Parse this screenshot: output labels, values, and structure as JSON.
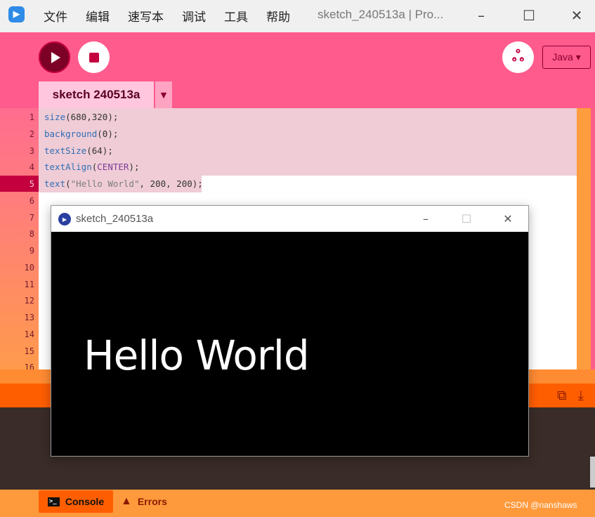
{
  "window": {
    "title": "sketch_240513a | Pro...",
    "menu": [
      "文件",
      "编辑",
      "速写本",
      "调试",
      "工具",
      "帮助"
    ]
  },
  "toolbar": {
    "mode": "Java ▾"
  },
  "editor": {
    "tab_label": "sketch 240513a",
    "line_numbers": [
      "1",
      "2",
      "3",
      "4",
      "5",
      "6",
      "7",
      "8",
      "9",
      "10",
      "11",
      "12",
      "13",
      "14",
      "15",
      "16"
    ],
    "code_lines": [
      "size(680,320);",
      "background(0);",
      "textSize(64);",
      "textAlign(CENTER);",
      "text(\"Hello World\", 200, 200);"
    ],
    "code_tokens": {
      "l1_fn": "size",
      "l1_rest": "(680,320);",
      "l2_fn": "background",
      "l2_rest": "(0);",
      "l3_fn": "textSize",
      "l3_rest": "(64);",
      "l4_fn": "textAlign",
      "l4_open": "(",
      "l4_const": "CENTER",
      "l4_close": ");",
      "l5_fn": "text",
      "l5_open": "(",
      "l5_str": "\"Hello World\"",
      "l5_rest": ", 200, 200);"
    }
  },
  "console": {
    "console_tab": "Console",
    "errors_tab": "Errors"
  },
  "sketch_window": {
    "title": "sketch_240513a",
    "output_text": "Hello World"
  },
  "watermark": "CSDN @nanshaws",
  "colors": {
    "toolbar_bg": "#ff5b8c",
    "console_bg": "#3a2c28",
    "accent": "#c4003f"
  }
}
